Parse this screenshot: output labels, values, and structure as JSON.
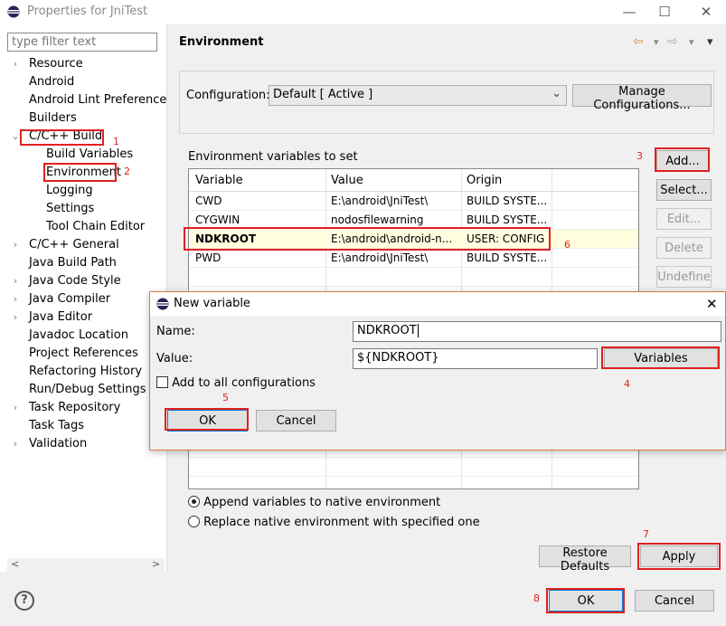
{
  "window": {
    "title": "Properties for JniTest",
    "minimize": "—",
    "maximize": "☐",
    "close": "✕"
  },
  "filter": {
    "placeholder": "type filter text"
  },
  "tree": [
    {
      "label": "Resource",
      "chevron": "›",
      "level": 0
    },
    {
      "label": "Android",
      "chevron": "",
      "level": 0
    },
    {
      "label": "Android Lint Preferences",
      "chevron": "",
      "level": 0
    },
    {
      "label": "Builders",
      "chevron": "",
      "level": 0
    },
    {
      "label": "C/C++ Build",
      "chevron": "⌄",
      "level": 0
    },
    {
      "label": "Build Variables",
      "chevron": "",
      "level": 1
    },
    {
      "label": "Environment",
      "chevron": "",
      "level": 1
    },
    {
      "label": "Logging",
      "chevron": "",
      "level": 1
    },
    {
      "label": "Settings",
      "chevron": "",
      "level": 1
    },
    {
      "label": "Tool Chain Editor",
      "chevron": "",
      "level": 1
    },
    {
      "label": "C/C++ General",
      "chevron": "›",
      "level": 0
    },
    {
      "label": "Java Build Path",
      "chevron": "",
      "level": 0
    },
    {
      "label": "Java Code Style",
      "chevron": "›",
      "level": 0
    },
    {
      "label": "Java Compiler",
      "chevron": "›",
      "level": 0
    },
    {
      "label": "Java Editor",
      "chevron": "›",
      "level": 0
    },
    {
      "label": "Javadoc Location",
      "chevron": "",
      "level": 0
    },
    {
      "label": "Project References",
      "chevron": "",
      "level": 0
    },
    {
      "label": "Refactoring History",
      "chevron": "",
      "level": 0
    },
    {
      "label": "Run/Debug Settings",
      "chevron": "",
      "level": 0
    },
    {
      "label": "Task Repository",
      "chevron": "›",
      "level": 0
    },
    {
      "label": "Task Tags",
      "chevron": "",
      "level": 0
    },
    {
      "label": "Validation",
      "chevron": "›",
      "level": 0
    }
  ],
  "scroll": {
    "left_arrow": "<",
    "right_arrow": ">"
  },
  "page": {
    "heading": "Environment",
    "nav_back": "⇦",
    "nav_back_menu": "▾",
    "nav_fwd": "⇨",
    "nav_fwd_menu": "▾",
    "view_menu": "▾"
  },
  "configuration": {
    "label": "Configuration:",
    "value": "Default  [ Active ]",
    "arrow": "⌄",
    "manage_button": "Manage Configurations..."
  },
  "env_table": {
    "title": "Environment variables to set",
    "headers": [
      "Variable",
      "Value",
      "Origin"
    ],
    "rows": [
      {
        "variable": "CWD",
        "value": "E:\\android\\JniTest\\",
        "origin": "BUILD SYSTE..."
      },
      {
        "variable": "CYGWIN",
        "value": "nodosfilewarning",
        "origin": "BUILD SYSTE..."
      },
      {
        "variable": "NDKROOT",
        "value": "E:\\android\\android-n...",
        "origin": "USER: CONFIG"
      },
      {
        "variable": "PWD",
        "value": "E:\\android\\JniTest\\",
        "origin": "BUILD SYSTE..."
      }
    ]
  },
  "side_buttons": {
    "add": "Add...",
    "select": "Select...",
    "edit": "Edit...",
    "delete": "Delete",
    "undefine": "Undefine"
  },
  "radios": {
    "append": "Append variables to native environment",
    "replace": "Replace native environment with specified one"
  },
  "restore_button": "Restore Defaults",
  "apply_button": "Apply",
  "footer": {
    "help": "?",
    "ok": "OK",
    "cancel": "Cancel"
  },
  "dialog": {
    "title": "New variable",
    "close": "✕",
    "name_label": "Name:",
    "name_value": "NDKROOT",
    "value_label": "Value:",
    "value_value": "${NDKROOT}",
    "variables_button": "Variables",
    "add_all_label": "Add to all configurations",
    "ok": "OK",
    "cancel": "Cancel"
  },
  "annotations": [
    "1",
    "2",
    "3",
    "4",
    "5",
    "6",
    "7",
    "8"
  ],
  "colors": {
    "annotation_red": "#e02020",
    "dialog_border": "#e07a3c",
    "highlight_row": "#ffffe0"
  }
}
